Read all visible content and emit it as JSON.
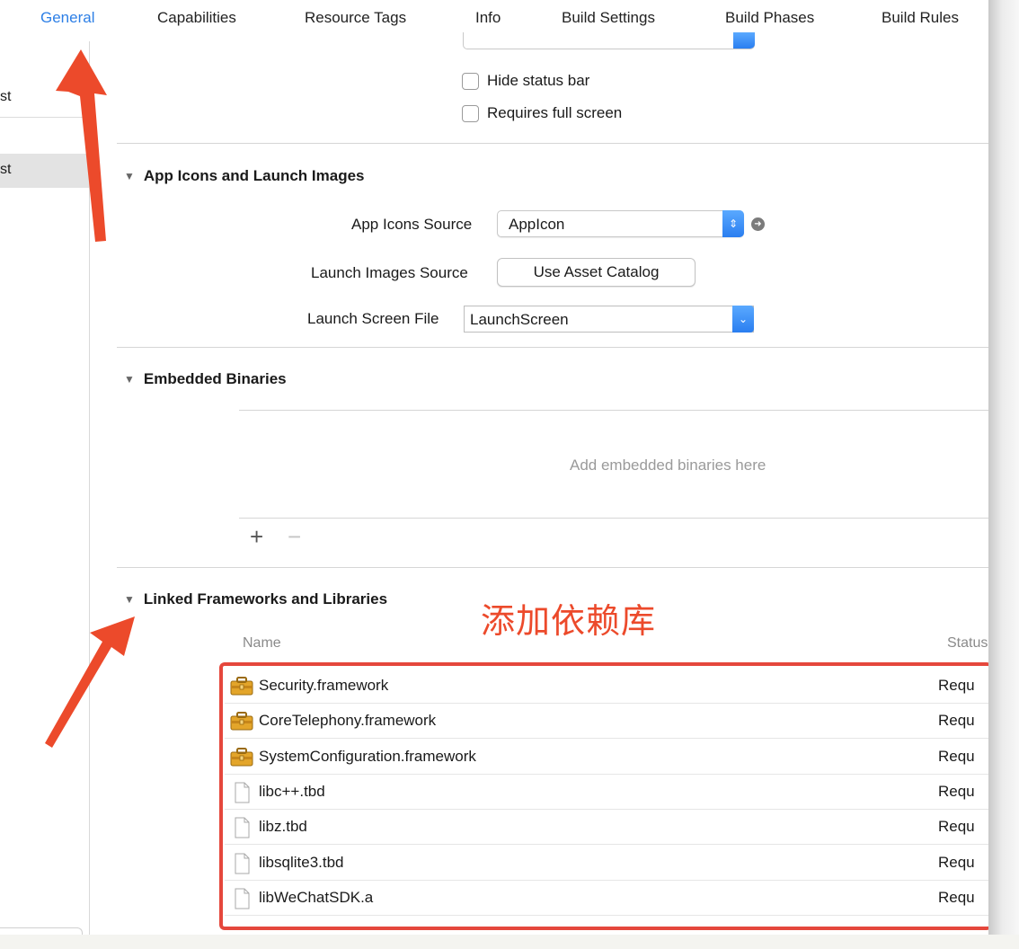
{
  "tabs": [
    {
      "label": "General",
      "active": true
    },
    {
      "label": "Capabilities"
    },
    {
      "label": "Resource Tags"
    },
    {
      "label": "Info"
    },
    {
      "label": "Build Settings"
    },
    {
      "label": "Build Phases"
    },
    {
      "label": "Build Rules"
    }
  ],
  "sidebar": {
    "items": [
      {
        "label": "st"
      },
      {
        "label": "st"
      }
    ]
  },
  "status_bar": {
    "hide_label": "Hide status bar",
    "full_screen_label": "Requires full screen"
  },
  "app_icons": {
    "section_title": "App Icons and Launch Images",
    "icons_source_label": "App Icons Source",
    "icons_source_value": "AppIcon",
    "launch_images_label": "Launch Images Source",
    "launch_images_button": "Use Asset Catalog",
    "launch_screen_label": "Launch Screen File",
    "launch_screen_value": "LaunchScreen"
  },
  "embedded": {
    "section_title": "Embedded Binaries",
    "placeholder": "Add embedded binaries here"
  },
  "linked": {
    "section_title": "Linked Frameworks and Libraries",
    "annotation": "添加依赖库",
    "columns": {
      "name": "Name",
      "status": "Status"
    },
    "rows": [
      {
        "name": "Security.framework",
        "status": "Requ",
        "kind": "framework"
      },
      {
        "name": "CoreTelephony.framework",
        "status": "Requ",
        "kind": "framework"
      },
      {
        "name": "SystemConfiguration.framework",
        "status": "Requ",
        "kind": "framework"
      },
      {
        "name": "libc++.tbd",
        "status": "Requ",
        "kind": "file"
      },
      {
        "name": "libz.tbd",
        "status": "Requ",
        "kind": "file"
      },
      {
        "name": "libsqlite3.tbd",
        "status": "Requ",
        "kind": "file"
      },
      {
        "name": "libWeChatSDK.a",
        "status": "Requ",
        "kind": "file"
      }
    ]
  },
  "colors": {
    "accent": "#2d7fe6",
    "annotation": "#ec4a2b",
    "highlight_box": "#e5473c"
  },
  "icons": {
    "framework": "toolbox-icon",
    "file": "document-icon"
  }
}
